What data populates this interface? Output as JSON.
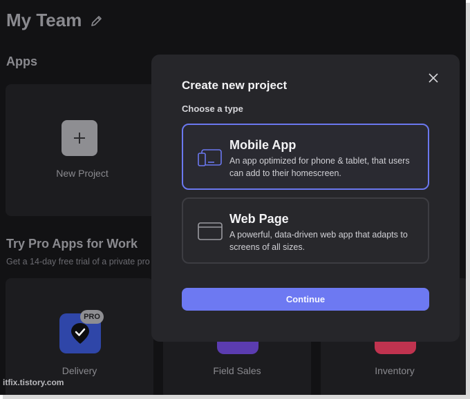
{
  "team": {
    "title": "My Team",
    "edit_icon": "pencil-icon"
  },
  "apps_section": {
    "title": "Apps",
    "new_project_label": "New Project"
  },
  "pro_section": {
    "title": "Try Pro Apps for Work",
    "subtitle": "Get a 14-day free trial of a private pro",
    "apps": [
      {
        "label": "Delivery",
        "badge": "PRO",
        "color": "#2f46a8"
      },
      {
        "label": "Field Sales",
        "color": "#5b3cb0"
      },
      {
        "label": "Inventory",
        "color": "#c0334f"
      }
    ]
  },
  "modal": {
    "title": "Create new project",
    "choose_label": "Choose a type",
    "options": [
      {
        "title": "Mobile App",
        "description": "An app optimized for phone & tablet, that users can add to their homescreen.",
        "icon": "mobile-device-icon",
        "selected": true
      },
      {
        "title": "Web Page",
        "description": "A powerful, data-driven web app that adapts to screens of all sizes.",
        "icon": "browser-window-icon",
        "selected": false
      }
    ],
    "continue_label": "Continue"
  },
  "watermark": "itfix.tistory.com",
  "colors": {
    "accent": "#6d79f2",
    "modal_bg": "#26262a",
    "page_bg": "#121214"
  }
}
